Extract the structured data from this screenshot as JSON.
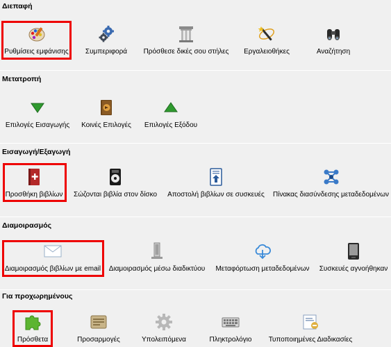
{
  "sections": [
    {
      "title": "Διεπαφή",
      "items": [
        {
          "label": "Ρυθμίσεις εμφάνισης",
          "icon": "palette-icon"
        },
        {
          "label": "Συμπεριφορά",
          "icon": "gears-icon"
        },
        {
          "label": "Πρόσθεσε δικές σου στήλες",
          "icon": "column-icon"
        },
        {
          "label": "Εργαλειοθήκες",
          "icon": "wand-icon"
        },
        {
          "label": "Αναζήτηση",
          "icon": "binoculars-icon"
        }
      ]
    },
    {
      "title": "Μετατροπή",
      "items": [
        {
          "label": "Επιλογές Εισαγωγής",
          "icon": "arrow-down-icon"
        },
        {
          "label": "Κοινές Επιλογές",
          "icon": "book-icon"
        },
        {
          "label": "Επιλογές Εξόδου",
          "icon": "arrow-up-icon"
        }
      ]
    },
    {
      "title": "Εισαγωγή/Εξαγωγή",
      "items": [
        {
          "label": "Προσθήκη βιβλίων",
          "icon": "add-book-icon"
        },
        {
          "label": "Σώζονται βιβλία στον δίσκο",
          "icon": "disk-icon"
        },
        {
          "label": "Αποστολή βιβλίων σε συσκευές",
          "icon": "send-device-icon"
        },
        {
          "label": "Πίνακας διασύνδεσης μεταδεδομένων",
          "icon": "metadata-network-icon"
        }
      ]
    },
    {
      "title": "Διαμοιρασμός",
      "items": [
        {
          "label": "Διαμοιρασμός βιβλίων με email",
          "icon": "envelope-icon"
        },
        {
          "label": "Διαμοιρασμός μέσω διαδικτύου",
          "icon": "server-icon"
        },
        {
          "label": "Μεταφόρτωση μεταδεδομένων",
          "icon": "cloud-download-icon"
        },
        {
          "label": "Συσκευές αγνοήθηκαν",
          "icon": "reader-device-icon"
        }
      ]
    },
    {
      "title": "Για προχωρημένους",
      "items": [
        {
          "label": "Πρόσθετα",
          "icon": "puzzle-icon"
        },
        {
          "label": "Προσαρμογές",
          "icon": "tweaks-icon"
        },
        {
          "label": "Υπολειπόμενα",
          "icon": "gear-icon"
        },
        {
          "label": "Πληκτρολόγιο",
          "icon": "keyboard-icon"
        },
        {
          "label": "Τυποποιημένες Διαδικασίες",
          "icon": "template-funcs-icon"
        }
      ]
    }
  ],
  "colors": {
    "highlight": "#ee0000",
    "arrow_green": "#2f9a2f",
    "puzzle_green": "#5cb531",
    "book_red": "#b32828"
  }
}
